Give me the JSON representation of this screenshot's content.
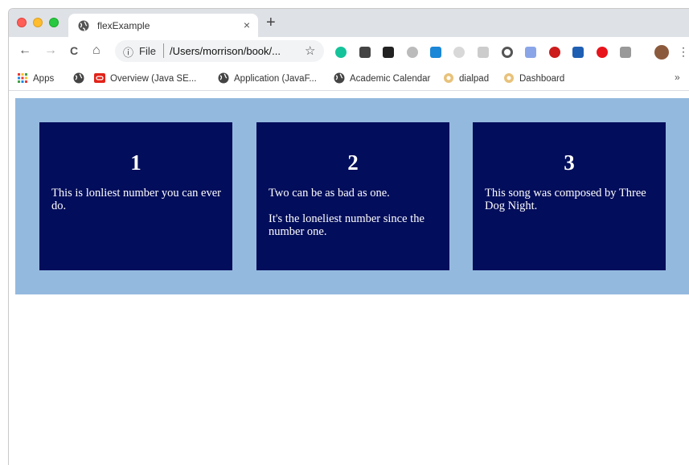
{
  "tab": {
    "title": "flexExample",
    "close": "×",
    "newtab": "+"
  },
  "toolbar": {
    "back": "←",
    "forward": "→",
    "reload": "C",
    "home": "⌂",
    "info": "ⓘ",
    "file_label": "File",
    "url": "/Users/morrison/book/...",
    "star": "☆",
    "menu": "⋮"
  },
  "bookmarks": {
    "items": [
      "Apps",
      "Overview (Java SE...",
      "Application (JavaF...",
      "Academic Calendar",
      "dialpad",
      "Dashboard"
    ],
    "more": "»"
  },
  "cards": [
    {
      "heading": "1",
      "paragraphs": [
        "This is lonliest number you can ever do."
      ]
    },
    {
      "heading": "2",
      "paragraphs": [
        "Two can be as bad as one.",
        "It's the loneliest number since the number one."
      ]
    },
    {
      "heading": "3",
      "paragraphs": [
        "This song was composed by Three Dog Night."
      ]
    }
  ],
  "colors": {
    "container": "#94b9df",
    "card": "#020d5b"
  }
}
